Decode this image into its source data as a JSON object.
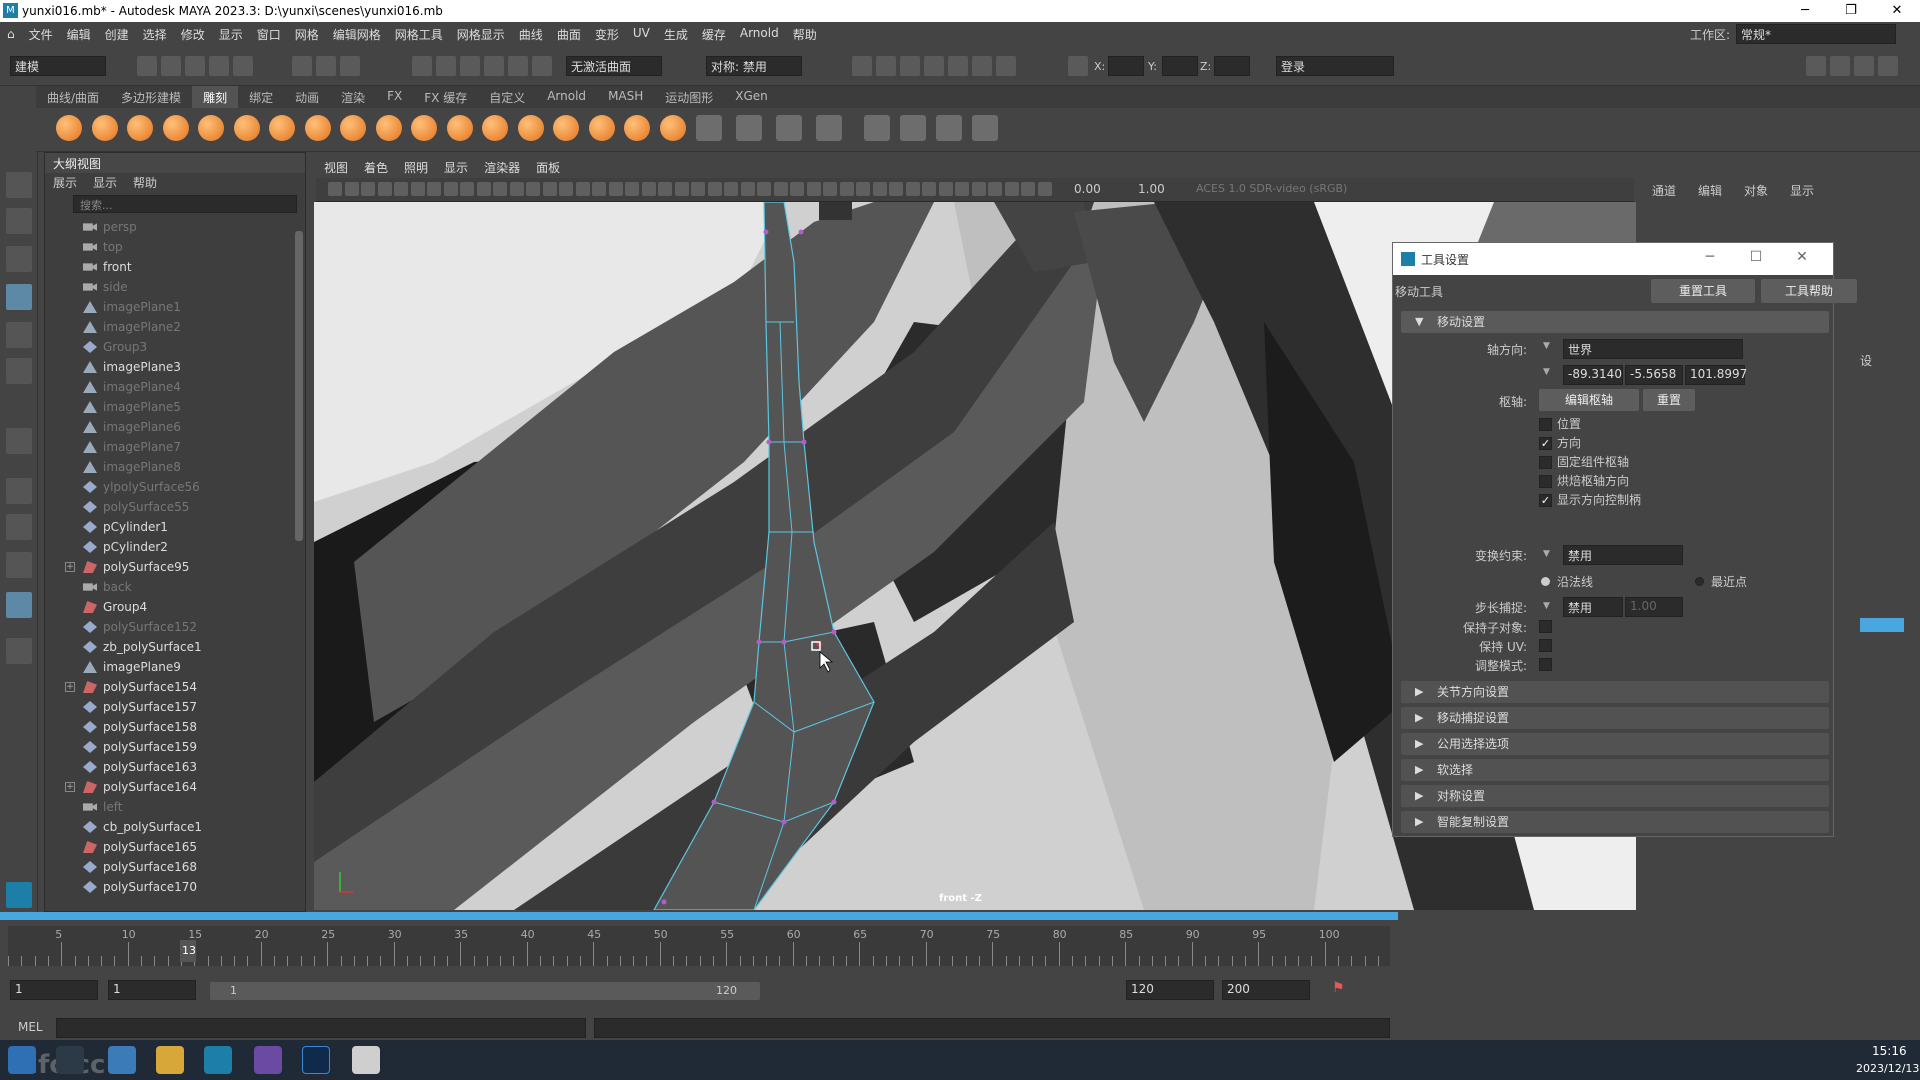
{
  "title": "yunxi016.mb* - Autodesk MAYA 2023.3: D:\\yunxi\\scenes\\yunxi016.mb",
  "menu": [
    "文件",
    "编辑",
    "创建",
    "选择",
    "修改",
    "显示",
    "窗口",
    "网格",
    "编辑网格",
    "网格工具",
    "网格显示",
    "曲线",
    "曲面",
    "变形",
    "UV",
    "生成",
    "缓存",
    "Arnold",
    "帮助"
  ],
  "workspace": {
    "label": "工作区:",
    "value": "常规*"
  },
  "status": {
    "mode": "建模",
    "live": "无激活曲面",
    "symmetry": "对称: 禁用",
    "x": "X:",
    "y": "Y:",
    "z": "Z:",
    "login": "登录"
  },
  "shelf_tabs": [
    "曲线/曲面",
    "多边形建模",
    "雕刻",
    "绑定",
    "动画",
    "渲染",
    "FX",
    "FX 缓存",
    "自定义",
    "Arnold",
    "MASH",
    "运动图形",
    "XGen"
  ],
  "shelf_active": "雕刻",
  "outliner": {
    "title": "大纲视图",
    "menu": [
      "展示",
      "显示",
      "帮助"
    ],
    "search": "搜索...",
    "items": [
      {
        "n": "persp",
        "t": "cam",
        "dim": true
      },
      {
        "n": "top",
        "t": "cam",
        "dim": true
      },
      {
        "n": "front",
        "t": "cam",
        "dim": false
      },
      {
        "n": "side",
        "t": "cam",
        "dim": true
      },
      {
        "n": "imagePlane1",
        "t": "img",
        "dim": true
      },
      {
        "n": "imagePlane2",
        "t": "img",
        "dim": true
      },
      {
        "n": "Group3",
        "t": "mesh",
        "dim": true
      },
      {
        "n": "imagePlane3",
        "t": "img",
        "dim": false
      },
      {
        "n": "imagePlane4",
        "t": "img",
        "dim": true
      },
      {
        "n": "imagePlane5",
        "t": "img",
        "dim": true
      },
      {
        "n": "imagePlane6",
        "t": "img",
        "dim": true
      },
      {
        "n": "imagePlane7",
        "t": "img",
        "dim": true
      },
      {
        "n": "imagePlane8",
        "t": "img",
        "dim": true
      },
      {
        "n": "ylpolySurface56",
        "t": "mesh",
        "dim": true
      },
      {
        "n": "polySurface55",
        "t": "mesh",
        "dim": true
      },
      {
        "n": "pCylinder1",
        "t": "mesh",
        "dim": false
      },
      {
        "n": "pCylinder2",
        "t": "mesh",
        "dim": false
      },
      {
        "n": "polySurface95",
        "t": "grp",
        "dim": false,
        "exp": true
      },
      {
        "n": "back",
        "t": "cam",
        "dim": true
      },
      {
        "n": "Group4",
        "t": "grp",
        "dim": false
      },
      {
        "n": "polySurface152",
        "t": "mesh",
        "dim": true
      },
      {
        "n": "zb_polySurface1",
        "t": "mesh",
        "dim": false
      },
      {
        "n": "imagePlane9",
        "t": "img",
        "dim": false
      },
      {
        "n": "polySurface154",
        "t": "grp",
        "dim": false,
        "exp": true
      },
      {
        "n": "polySurface157",
        "t": "mesh",
        "dim": false
      },
      {
        "n": "polySurface158",
        "t": "mesh",
        "dim": false
      },
      {
        "n": "polySurface159",
        "t": "mesh",
        "dim": false
      },
      {
        "n": "polySurface163",
        "t": "mesh",
        "dim": false
      },
      {
        "n": "polySurface164",
        "t": "grp",
        "dim": false,
        "exp": true
      },
      {
        "n": "left",
        "t": "cam",
        "dim": true
      },
      {
        "n": "cb_polySurface1",
        "t": "mesh",
        "dim": false
      },
      {
        "n": "polySurface165",
        "t": "grp",
        "dim": false
      },
      {
        "n": "polySurface168",
        "t": "mesh",
        "dim": false
      },
      {
        "n": "polySurface170",
        "t": "mesh",
        "dim": false
      }
    ]
  },
  "viewport": {
    "menu": [
      "视图",
      "着色",
      "照明",
      "显示",
      "渲染器",
      "面板"
    ],
    "val1": "0.00",
    "val2": "1.00",
    "colorspace": "ACES 1.0 SDR-video (sRGB)",
    "label": "front -Z"
  },
  "channel_box": {
    "menu": [
      "通道",
      "编辑",
      "对象",
      "显示"
    ],
    "side_text": "设"
  },
  "tool_settings": {
    "title": "工具设置",
    "tool": "移动工具",
    "reset": "重置工具",
    "help": "工具帮助",
    "section": "移动设置",
    "axis_label": "轴方向:",
    "axis_value": "世界",
    "coords": [
      "-89.3140",
      "-5.5658",
      "101.8997"
    ],
    "pivot_label": "枢轴:",
    "pivot_edit": "编辑枢轴",
    "pivot_reset": "重置",
    "checks": [
      {
        "l": "位置",
        "c": false
      },
      {
        "l": "方向",
        "c": true
      },
      {
        "l": "固定组件枢轴",
        "c": false
      },
      {
        "l": "烘焙枢轴方向",
        "c": false
      },
      {
        "l": "显示方向控制柄",
        "c": true
      }
    ],
    "constraint_label": "变换约束:",
    "constraint_value": "禁用",
    "radio1": "沿法线",
    "radio2": "最近点",
    "step_label": "步长捕捉:",
    "step_value": "禁用",
    "step_num": "1.00",
    "keep_children": "保持子对象:",
    "keep_uv": "保持 UV:",
    "adjust": "调整模式:",
    "sections": [
      "关节方向设置",
      "移动捕捉设置",
      "公用选择选项",
      "软选择",
      "对称设置",
      "智能复制设置"
    ]
  },
  "timeline": {
    "ticks": [
      "5",
      "10",
      "15",
      "20",
      "25",
      "30",
      "35",
      "40",
      "45",
      "50",
      "55",
      "60",
      "65",
      "70",
      "75",
      "80",
      "85",
      "90",
      "95",
      "100"
    ],
    "current": "13"
  },
  "range": {
    "start": "1",
    "start2": "1",
    "inner_start": "1",
    "inner_end": "120",
    "end": "120",
    "end2": "200"
  },
  "cmd": "MEL",
  "clock": {
    "time": "15:16",
    "date": "2023/12/13"
  },
  "watermark": "tafc.cc"
}
